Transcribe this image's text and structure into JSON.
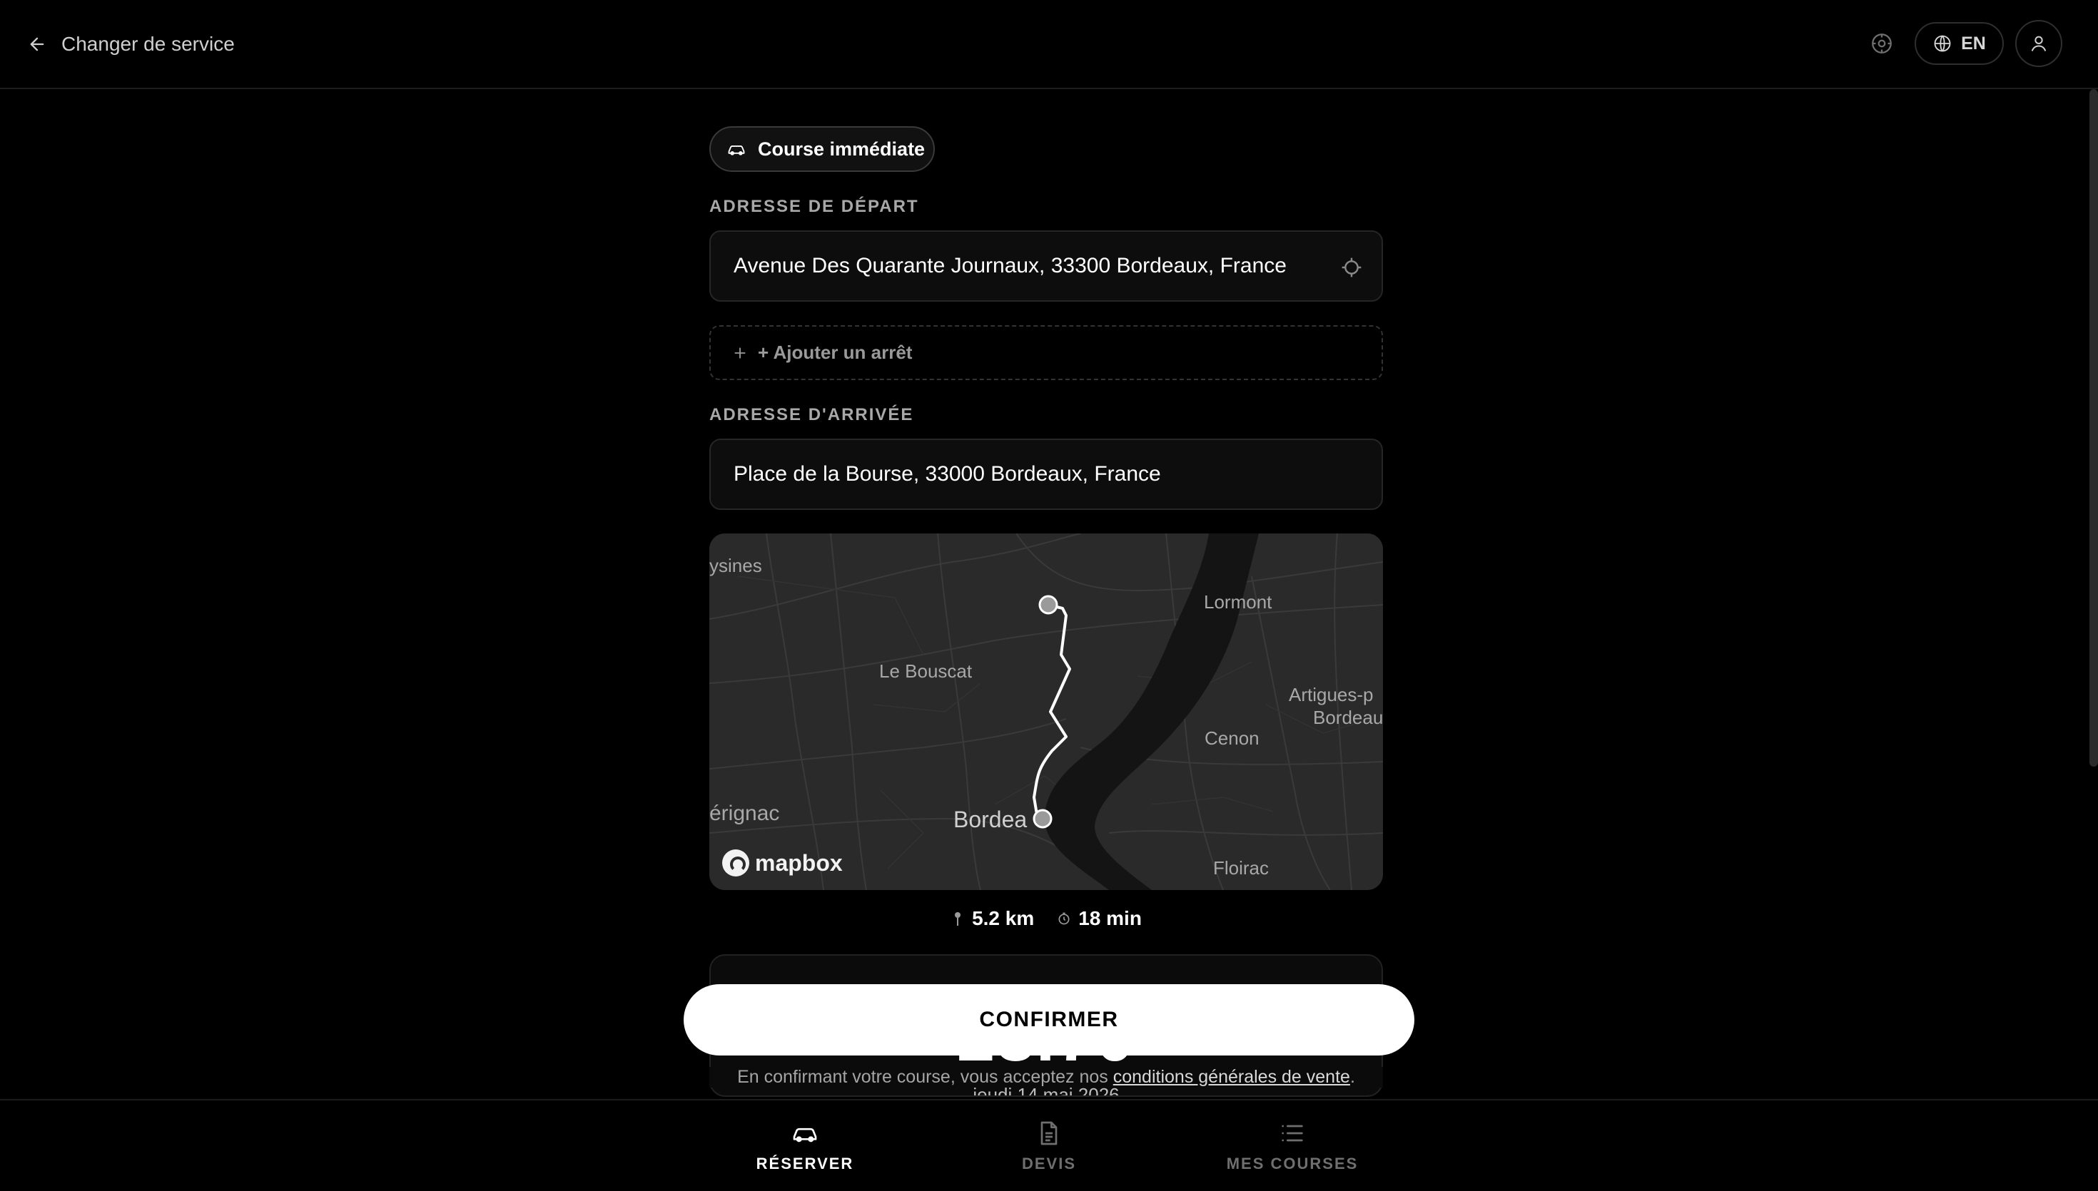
{
  "header": {
    "back_label": "Changer de service",
    "language": "EN",
    "icons": [
      "arrow-left-icon",
      "compass-icon",
      "globe-icon",
      "user-icon"
    ]
  },
  "ride_type": {
    "label": "Course immédiate",
    "icon": "car-icon"
  },
  "departure": {
    "label": "ADRESSE DE DÉPART",
    "value": "Avenue Des Quarante Journaux, 33300 Bordeaux, France"
  },
  "add_stop": {
    "label": "+ Ajouter un arrêt"
  },
  "arrival": {
    "label": "ADRESSE D'ARRIVÉE",
    "value": "Place de la Bourse, 33000 Bordeaux, France"
  },
  "map": {
    "places": [
      "ysines",
      "Lormont",
      "Le Bouscat",
      "Artigues-p",
      "Bordeau",
      "Cenon",
      "érignac",
      "Bordea",
      "Floirac"
    ],
    "attribution": "mapbox",
    "colors": {
      "land": "#2a2a2a",
      "river": "#141414",
      "route": "#ffffff"
    }
  },
  "trip": {
    "distance": "5.2 km",
    "duration": "18 min"
  },
  "price": {
    "amount": "28.70",
    "date": "jeudi 14 mai 2026"
  },
  "confirm": {
    "label": "CONFIRMER"
  },
  "terms": {
    "prefix": "En confirmant votre course, vous acceptez nos",
    "link": "conditions générales de vente",
    "suffix": "."
  },
  "nav": {
    "items": [
      {
        "label": "RÉSERVER",
        "icon": "car-icon",
        "active": true
      },
      {
        "label": "DEVIS",
        "icon": "document-icon",
        "active": false
      },
      {
        "label": "MES COURSES",
        "icon": "list-icon",
        "active": false
      }
    ]
  }
}
